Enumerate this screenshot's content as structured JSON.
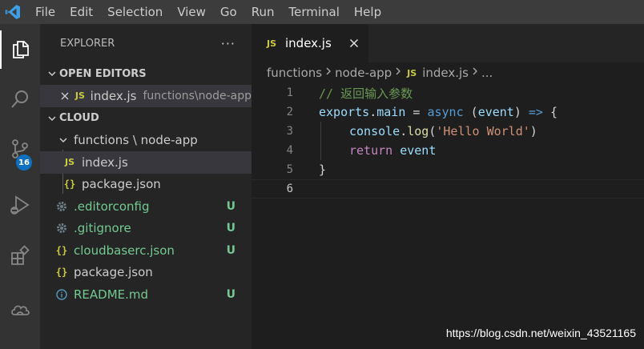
{
  "menu": [
    "File",
    "Edit",
    "Selection",
    "View",
    "Go",
    "Run",
    "Terminal",
    "Help"
  ],
  "activity": {
    "scm_badge": "16"
  },
  "explorer": {
    "title": "EXPLORER",
    "more": "···",
    "open_editors": {
      "header": "OPEN EDITORS",
      "items": [
        {
          "icon": "JS",
          "name": "index.js",
          "desc": "functions\\node-app"
        }
      ]
    },
    "workspace": {
      "header": "CLOUD",
      "folder": "functions \\ node-app",
      "folder_files": [
        {
          "icon": "JS",
          "name": "index.js"
        },
        {
          "icon": "{}",
          "name": "package.json"
        }
      ],
      "root_files": [
        {
          "icon": "gear-icon",
          "name": ".editorconfig",
          "status": "U"
        },
        {
          "icon": "gear-icon",
          "name": ".gitignore",
          "status": "U"
        },
        {
          "icon": "{}",
          "name": "cloudbaserc.json",
          "status": "U"
        },
        {
          "icon": "{}",
          "name": "package.json",
          "status": ""
        },
        {
          "icon": "info-icon",
          "name": "README.md",
          "status": "U"
        }
      ]
    }
  },
  "editor": {
    "tab": {
      "icon": "JS",
      "name": "index.js"
    },
    "breadcrumb": {
      "parts": [
        "functions",
        "node-app"
      ],
      "file_icon": "JS",
      "file": "index.js",
      "tail": "..."
    },
    "lines": [
      {
        "n": "1"
      },
      {
        "n": "2"
      },
      {
        "n": "3"
      },
      {
        "n": "4"
      },
      {
        "n": "5"
      },
      {
        "n": "6"
      }
    ],
    "code": {
      "l1_comment": "// 返回输入参数",
      "l2_obj": "exports",
      "l2_dot": ".",
      "l2_prop": "main",
      "l2_eq": " = ",
      "l2_async": "async",
      "l2_paren_open": " (",
      "l2_param": "event",
      "l2_paren_close": ") ",
      "l2_arrow": "=>",
      "l2_brace": " {",
      "l3_obj": "console",
      "l3_dot": ".",
      "l3_fn": "log",
      "l3_open": "(",
      "l3_str": "'Hello World'",
      "l3_close": ")",
      "l4_kw": "return",
      "l4_var": " event",
      "l5_brace": "}"
    }
  },
  "watermark": "https://blog.csdn.net/weixin_43521165",
  "colors": {
    "accent": "#0e70c0",
    "git_untracked": "#73c991",
    "js_icon": "#cbcb41"
  }
}
